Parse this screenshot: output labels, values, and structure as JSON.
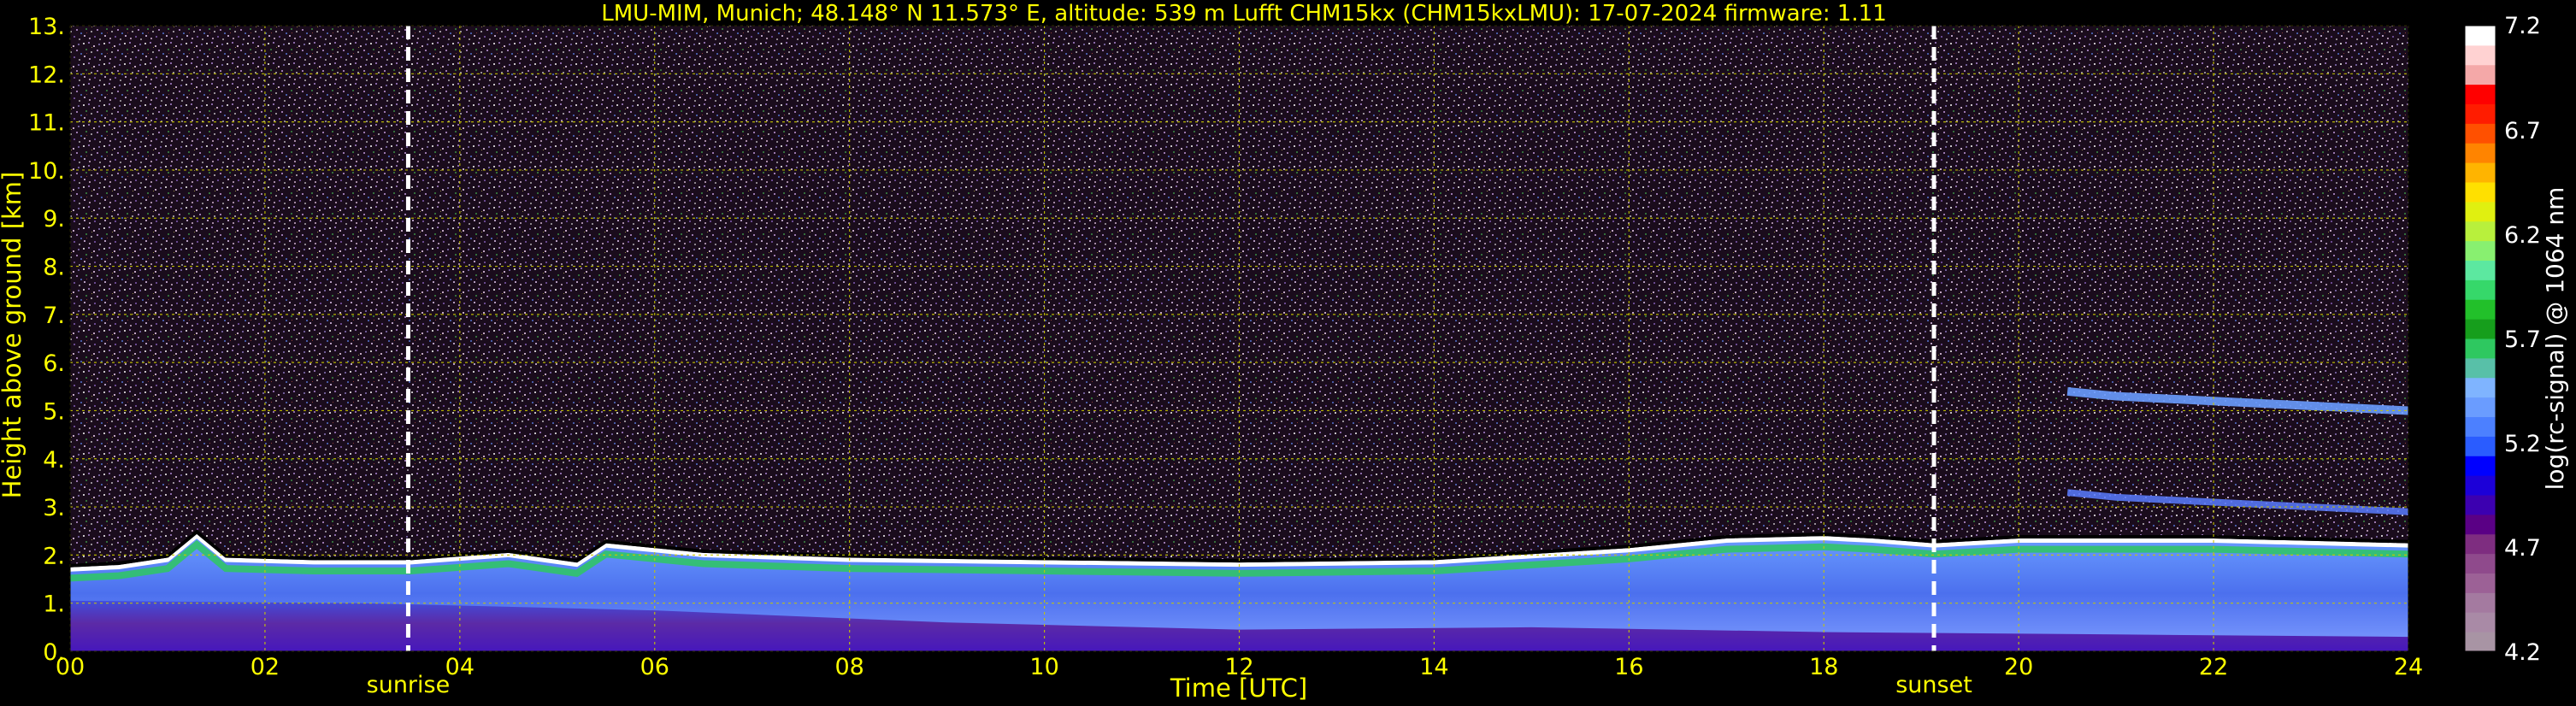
{
  "title": "LMU-MIM, Munich; 48.148° N 11.573° E, altitude: 539 m    Lufft CHM15kx (CHM15kxLMU): 17-07-2024    firmware: 1.11",
  "colors": {
    "background": "#000000",
    "axis_text": "#ffff00",
    "grid": "#c8c800",
    "marker_line": "#ffffff",
    "colorbar_text": "#ffffff"
  },
  "chart_data": {
    "type": "heatmap",
    "title": "LMU-MIM, Munich; 48.148° N 11.573° E, altitude: 539 m    Lufft CHM15kx (CHM15kxLMU): 17-07-2024    firmware: 1.11",
    "xlabel": "Time [UTC]",
    "ylabel": "Height above ground [km]",
    "xlim": [
      0,
      24
    ],
    "ylim": [
      0,
      13
    ],
    "grid": true,
    "x_ticks": [
      0,
      2,
      4,
      6,
      8,
      10,
      12,
      14,
      16,
      18,
      20,
      22,
      24
    ],
    "x_tick_labels": [
      "00",
      "02",
      "04",
      "06",
      "08",
      "10",
      "12",
      "14",
      "16",
      "18",
      "20",
      "22",
      "24"
    ],
    "y_ticks": [
      0,
      1,
      2,
      3,
      4,
      5,
      6,
      7,
      8,
      9,
      10,
      11,
      12,
      13
    ],
    "y_tick_labels": [
      "0.",
      "1.",
      "2.",
      "3.",
      "4.",
      "5.",
      "6.",
      "7.",
      "8.",
      "9.",
      "10.",
      "11.",
      "12.",
      "13."
    ],
    "annotations": [
      {
        "label": "sunrise",
        "x": 3.47
      },
      {
        "label": "sunset",
        "x": 19.13
      }
    ],
    "colorbar": {
      "label": "log(rc-signal) @ 1064 nm",
      "range": [
        4.2,
        7.2
      ],
      "ticks": [
        4.2,
        4.7,
        5.2,
        5.7,
        6.2,
        6.7,
        7.2
      ],
      "tick_labels": [
        "4.2",
        "4.7",
        "5.2",
        "5.7",
        "6.2",
        "6.7",
        "7.2"
      ],
      "colors": [
        "#a894a4",
        "#a98aa6",
        "#a47aa0",
        "#9c6196",
        "#8f4a8c",
        "#7e2d80",
        "#5a0085",
        "#3c00b0",
        "#1c00d8",
        "#0000ff",
        "#2a5cff",
        "#4c80ff",
        "#6a9cff",
        "#7fb4ff",
        "#58c0a8",
        "#2ec860",
        "#169e1c",
        "#22c02a",
        "#36d86a",
        "#5ce8a0",
        "#88f070",
        "#b8f03c",
        "#e0f010",
        "#ffe000",
        "#ffb400",
        "#ff8400",
        "#ff5000",
        "#ff1c00",
        "#ff0000",
        "#f4a8a8",
        "#ffd2d2",
        "#ffffff"
      ]
    },
    "boundary_layer_height_km": {
      "x": [
        0,
        0.5,
        1.0,
        1.3,
        1.6,
        2.5,
        3.5,
        4.5,
        5.2,
        5.5,
        6.5,
        8,
        10,
        12,
        14,
        16,
        17,
        18,
        18.5,
        19.13,
        20,
        22,
        24
      ],
      "y": [
        1.7,
        1.75,
        1.9,
        2.4,
        1.9,
        1.85,
        1.85,
        2.0,
        1.8,
        2.2,
        2.0,
        1.9,
        1.85,
        1.8,
        1.85,
        2.1,
        2.3,
        2.35,
        2.3,
        2.2,
        2.3,
        2.3,
        2.2
      ]
    },
    "residual_layer_km": {
      "x": [
        20.5,
        21,
        22,
        23,
        24
      ],
      "y": [
        5.4,
        5.3,
        5.2,
        5.1,
        5.0
      ]
    }
  }
}
